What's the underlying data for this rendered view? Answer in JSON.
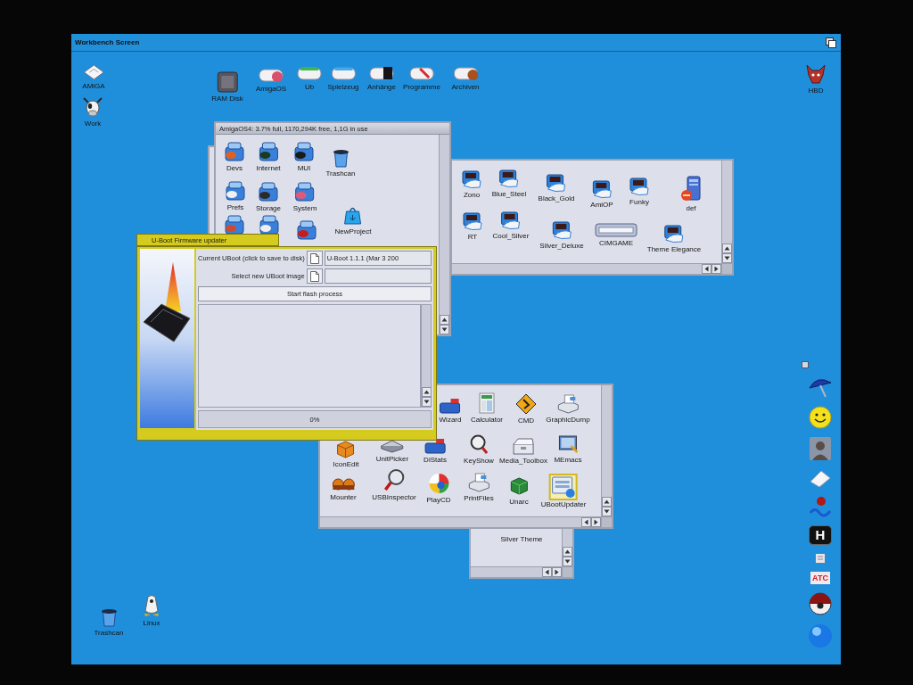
{
  "screen": {
    "title": "Workbench Screen"
  },
  "desktop_icons": [
    {
      "kind": "floppy",
      "label": "AMiGA",
      "selected": false
    },
    {
      "kind": "cow",
      "label": "Work",
      "selected": false
    },
    {
      "kind": "ram",
      "label": "RAM Disk",
      "selected": false
    },
    {
      "kind": "drive",
      "label": "AmigaOS",
      "selected": false
    },
    {
      "kind": "drive",
      "label": "Ub",
      "selected": false
    },
    {
      "kind": "drive",
      "label": "Spielzeug",
      "selected": false
    },
    {
      "kind": "drive",
      "label": "Anhänge",
      "selected": false
    },
    {
      "kind": "drive",
      "label": "Programme",
      "selected": false
    },
    {
      "kind": "drive",
      "label": "Archiven",
      "selected": false
    },
    {
      "kind": "creature",
      "label": "HBD",
      "selected": false
    },
    {
      "kind": "trash",
      "label": "Trashcan",
      "selected": false
    },
    {
      "kind": "penguin",
      "label": "Linux",
      "selected": false
    }
  ],
  "windows": [
    {
      "kind": "drawer",
      "active": false
    },
    {
      "kind": "drawer",
      "active": false,
      "icons": [
        {
          "kind": "theme",
          "label": "Zono",
          "selected": false
        },
        {
          "kind": "theme",
          "label": "Blue_Steel",
          "selected": false
        },
        {
          "kind": "theme",
          "label": "Black_Gold",
          "selected": false
        },
        {
          "kind": "theme",
          "label": "AmiOP",
          "selected": false
        },
        {
          "kind": "theme",
          "label": "Funky",
          "selected": false
        },
        {
          "kind": "tower",
          "label": "def",
          "selected": false
        },
        {
          "kind": "theme",
          "label": "RT",
          "selected": false
        },
        {
          "kind": "theme",
          "label": "Cool_Silver",
          "selected": false
        },
        {
          "kind": "theme",
          "label": "Silver_Deluxe",
          "selected": false
        },
        {
          "kind": "bar",
          "label": "CIMGAME",
          "selected": false
        },
        {
          "kind": "theme",
          "label": "Theme Elegance",
          "selected": false
        }
      ]
    },
    {
      "kind": "drawer",
      "active": false,
      "title": "AmigaOS4: 3.7% full, 1170,294K free, 1,1G in use",
      "icons": [
        {
          "kind": "drawer",
          "label": "Devs",
          "selected": false
        },
        {
          "kind": "drawer",
          "label": "Internet",
          "selected": false
        },
        {
          "kind": "drawer",
          "label": "MUI",
          "selected": false
        },
        {
          "kind": "trash",
          "label": "Trashcan",
          "selected": false
        },
        {
          "kind": "drawer",
          "label": "Prefs",
          "selected": false
        },
        {
          "kind": "drawer",
          "label": "Storage",
          "selected": false
        },
        {
          "kind": "drawer",
          "label": "System",
          "selected": false
        },
        {
          "kind": "project",
          "label": "NewProject",
          "selected": false
        },
        {
          "kind": "drawer",
          "selected": false
        },
        {
          "kind": "drawer",
          "selected": false
        },
        {
          "kind": "drawer",
          "selected": false
        }
      ]
    },
    {
      "kind": "drawer",
      "active": false,
      "icons": [
        {
          "label": "Silver Theme",
          "selected": false
        }
      ]
    },
    {
      "kind": "drawer",
      "active": false,
      "icons": [
        {
          "kind": "panel",
          "label": "Wizard",
          "selected": false
        },
        {
          "kind": "calculator",
          "label": "Calculator",
          "selected": false
        },
        {
          "kind": "sign",
          "label": "CMD",
          "selected": false
        },
        {
          "kind": "printer",
          "label": "GraphicDump",
          "selected": false
        },
        {
          "kind": "box",
          "label": "IconEdit",
          "selected": false
        },
        {
          "kind": "device",
          "label": "UnitPicker",
          "selected": false
        },
        {
          "kind": "panel",
          "label": "DiStats",
          "selected": false
        },
        {
          "kind": "magnifier",
          "label": "KeyShow",
          "selected": false
        },
        {
          "kind": "toolbox",
          "label": "Media_Toolbox",
          "selected": false
        },
        {
          "kind": "monitor",
          "label": "MEmacs",
          "selected": false
        },
        {
          "kind": "capsules",
          "label": "Mounter",
          "selected": false
        },
        {
          "kind": "inspector",
          "label": "USBInspector",
          "selected": false
        },
        {
          "kind": "disc",
          "label": "PlayCD",
          "selected": false
        },
        {
          "kind": "printer",
          "label": "PrintFiles",
          "selected": false
        },
        {
          "kind": "cube",
          "label": "Unarc",
          "selected": false
        },
        {
          "kind": "updater",
          "label": "UBootUpdater",
          "selected": true
        }
      ]
    },
    {
      "kind": "updater",
      "active": true,
      "title": "U-Boot Firmware updater",
      "current_label": "Current UBoot (click to save to disk)",
      "current_value": "U-Boot 1.1.1 (Mar 3 200",
      "select_label": "Select new UBoot image",
      "start_button": "Start flash process",
      "progress": {
        "level": 0,
        "reading": "0%"
      }
    }
  ],
  "dock": [
    {
      "kind": "handle"
    },
    {
      "kind": "umbrella"
    },
    {
      "kind": "smiley"
    },
    {
      "kind": "photo"
    },
    {
      "kind": "eraser"
    },
    {
      "kind": "wave"
    },
    {
      "kind": "plaque",
      "text": "H"
    },
    {
      "kind": "box"
    },
    {
      "kind": "tag",
      "text": "ATC"
    },
    {
      "kind": "ball"
    },
    {
      "kind": "globe"
    }
  ]
}
